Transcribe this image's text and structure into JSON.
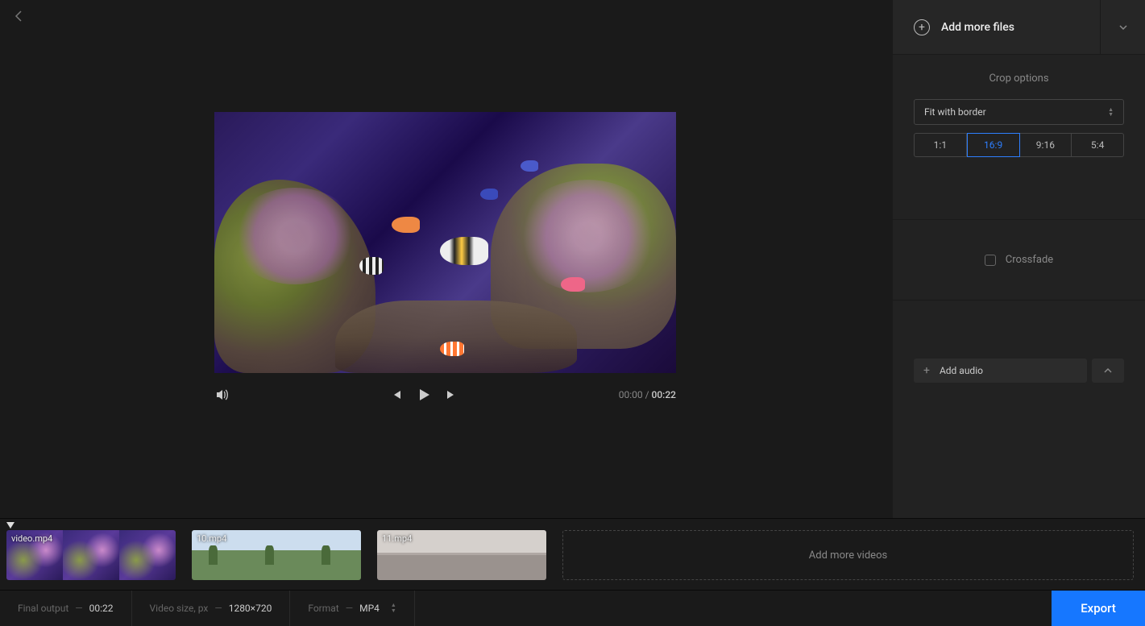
{
  "header": {
    "add_files_label": "Add more files"
  },
  "crop": {
    "title": "Crop options",
    "mode": "Fit with border",
    "ratios": [
      "1:1",
      "16:9",
      "9:16",
      "5:4"
    ],
    "active_ratio": "16:9"
  },
  "crossfade": {
    "label": "Crossfade",
    "checked": false
  },
  "audio": {
    "add_label": "Add audio"
  },
  "player": {
    "current_time": "00:00",
    "total_time": "00:22"
  },
  "timeline": {
    "clips": [
      {
        "name": "video.mp4"
      },
      {
        "name": "10.mp4"
      },
      {
        "name": "11.mp4"
      }
    ],
    "add_more_label": "Add more videos"
  },
  "footer": {
    "final_output_label": "Final output",
    "final_output_value": "00:22",
    "video_size_label": "Video size, px",
    "video_size_value": "1280×720",
    "format_label": "Format",
    "format_value": "MP4",
    "export_label": "Export"
  }
}
